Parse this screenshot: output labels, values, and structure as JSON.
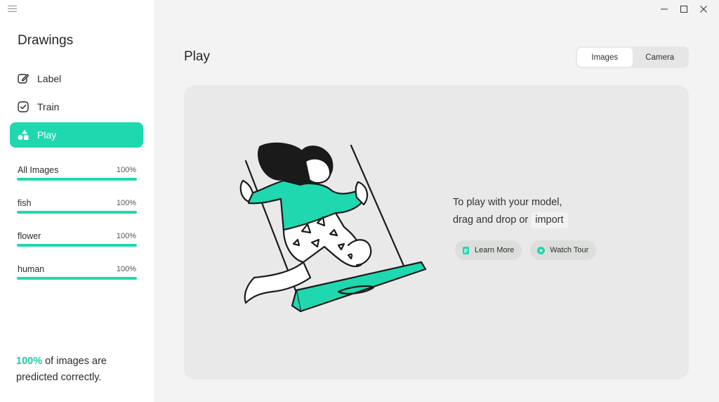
{
  "app": {
    "title": "Drawings"
  },
  "nav": {
    "items": [
      {
        "label": "Label",
        "icon": "edit-icon"
      },
      {
        "label": "Train",
        "icon": "checkbox-icon"
      },
      {
        "label": "Play",
        "icon": "shapes-icon",
        "active": true
      }
    ]
  },
  "labels": [
    {
      "name": "All Images",
      "percent": "100%",
      "progress": 1.0
    },
    {
      "name": "fish",
      "percent": "100%",
      "progress": 1.0
    },
    {
      "name": "flower",
      "percent": "100%",
      "progress": 1.0
    },
    {
      "name": "human",
      "percent": "100%",
      "progress": 1.0
    }
  ],
  "summary": {
    "value": "100%",
    "text_line1": " of images are",
    "text_line2": "predicted correctly."
  },
  "main": {
    "title": "Play",
    "toggle": {
      "images_label": "Images",
      "camera_label": "Camera",
      "selected": "Images"
    },
    "prompt": {
      "line1": "To play with your model,",
      "line2": "drag and drop or",
      "import_label": "import"
    },
    "buttons": {
      "learn_more": "Learn More",
      "watch_tour": "Watch Tour"
    }
  },
  "colors": {
    "accent": "#1fd8b0",
    "sidebar_bg": "#ffffff",
    "content_bg": "#f3f3f3",
    "drop_bg": "#e8e9e8"
  }
}
